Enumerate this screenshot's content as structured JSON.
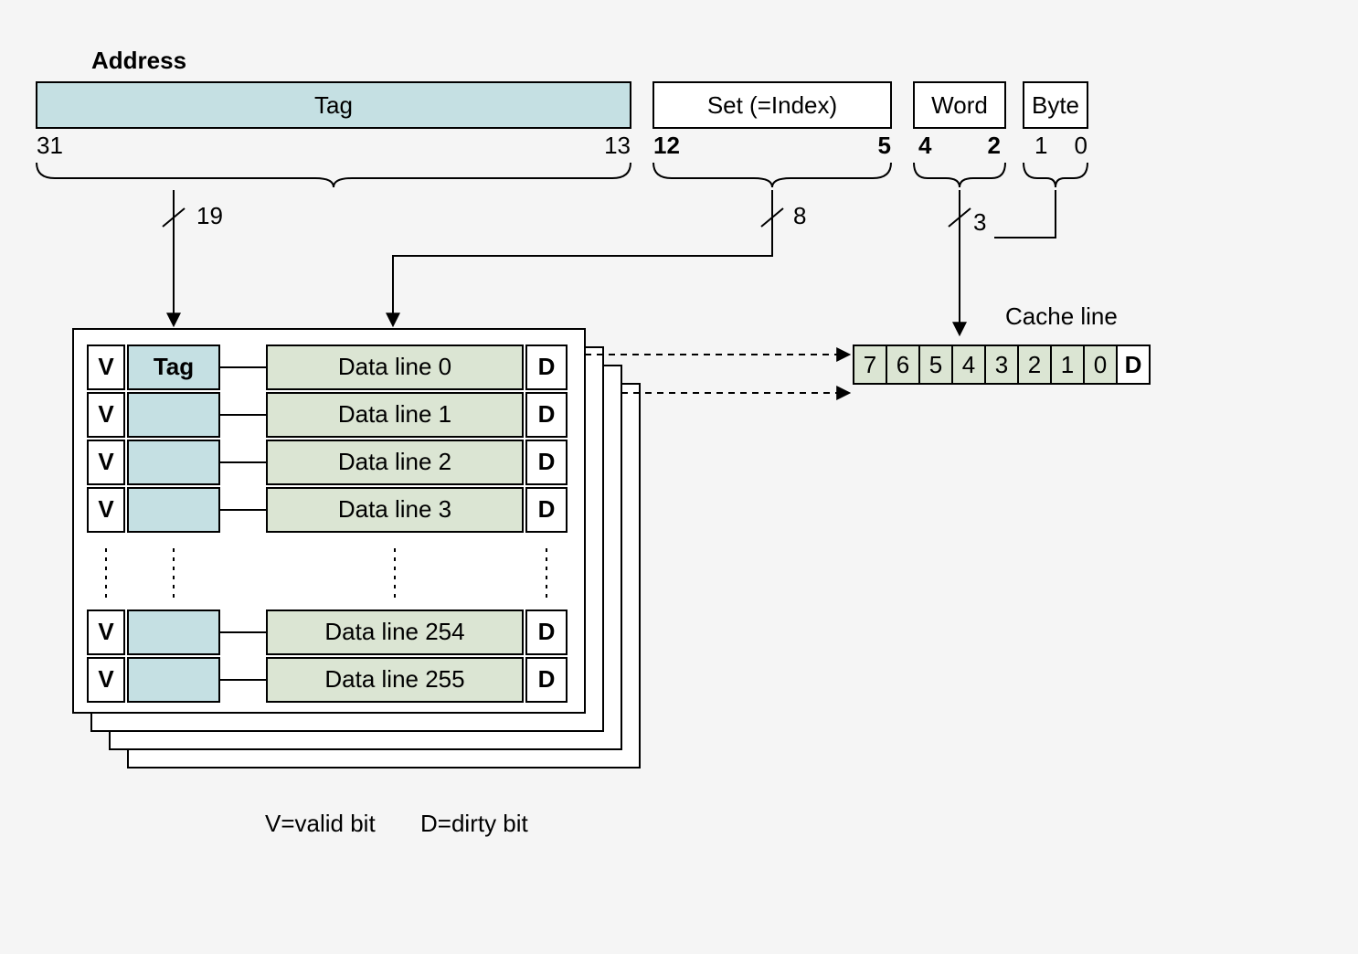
{
  "diagram": {
    "title": "Address",
    "fields": {
      "tag": {
        "label": "Tag",
        "hi": "31",
        "lo": "13",
        "width_bits": "19"
      },
      "set": {
        "label": "Set (=Index)",
        "hi": "12",
        "lo": "5",
        "width_bits": "8"
      },
      "word": {
        "label": "Word",
        "hi": "4",
        "lo": "2",
        "width_bits": "3"
      },
      "byte": {
        "label": "Byte",
        "hi": "1",
        "lo": "0"
      }
    },
    "cache_line_label": "Cache line",
    "cache_line_cells": [
      "7",
      "6",
      "5",
      "4",
      "3",
      "2",
      "1",
      "0",
      "D"
    ],
    "ways_rows": {
      "v": "V",
      "tag_header": "Tag",
      "d": "D",
      "data_lines_top": [
        "Data line 0",
        "Data line 1",
        "Data line 2",
        "Data line 3"
      ],
      "data_lines_bottom": [
        "Data line 254",
        "Data line 255"
      ]
    },
    "legend": {
      "valid": "V=valid bit",
      "dirty": "D=dirty bit"
    },
    "colors": {
      "tag_fill": "#c5e0e3",
      "data_fill": "#dbe5d3",
      "stroke": "#000000",
      "bg": "#f5f5f5"
    }
  }
}
